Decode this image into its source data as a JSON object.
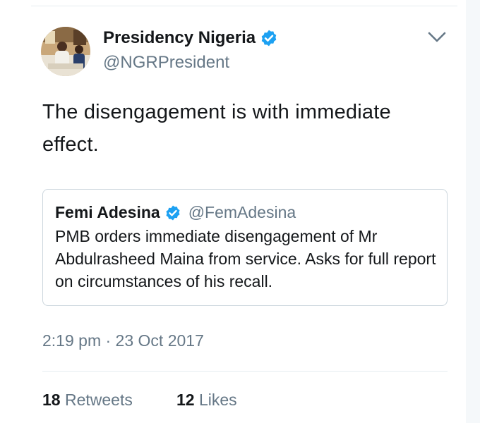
{
  "tweet": {
    "author_name": "Presidency Nigeria",
    "author_handle": "@NGRPresident",
    "text": "The disengagement is with immediate effect.",
    "timestamp": "2:19 pm · 23 Oct 2017",
    "verified_color": "#1da1f2",
    "icons": {
      "verified": "verified-badge-icon",
      "menu": "chevron-down-icon"
    }
  },
  "quoted_tweet": {
    "author_name": "Femi Adesina",
    "author_handle": "@FemAdesina",
    "text": "PMB orders immediate disengagement of Mr Abdulrasheed Maina from service. Asks for full report on circumstances of his recall."
  },
  "stats": {
    "retweets_count": "18",
    "retweets_label": "Retweets",
    "likes_count": "12",
    "likes_label": "Likes"
  }
}
